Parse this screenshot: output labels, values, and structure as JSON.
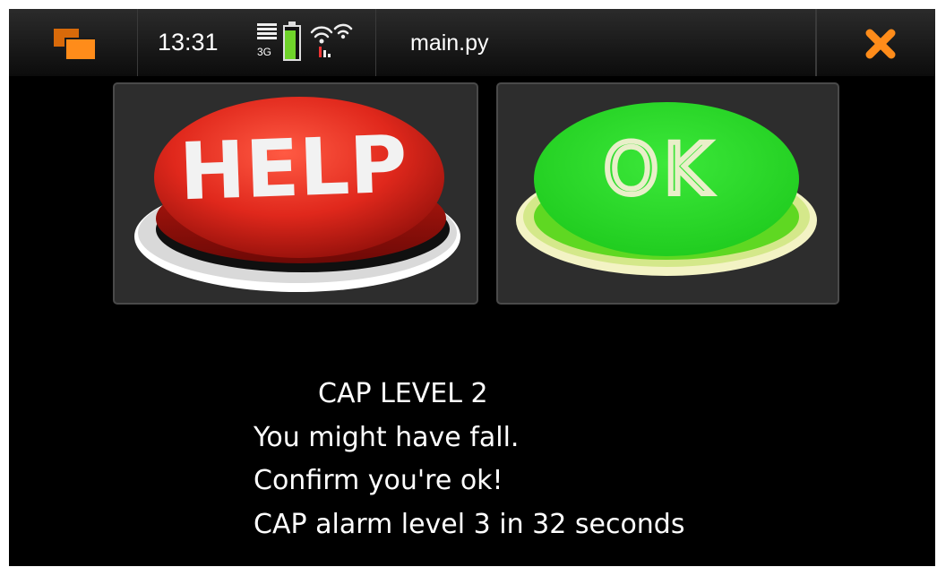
{
  "statusbar": {
    "time": "13:31",
    "network_type": "3G",
    "app_title": "main.py",
    "icons": [
      "task-switcher-icon",
      "signal-strength-icon",
      "battery-icon",
      "wifi-icon",
      "close-icon"
    ]
  },
  "buttons": {
    "help_label": "HELP",
    "ok_label": "OK"
  },
  "message": {
    "title": "CAP LEVEL 2",
    "line1": "You might have fall.",
    "line2": "Confirm you're ok!",
    "line3": "CAP alarm level 3 in 32 seconds"
  },
  "colors": {
    "accent": "#ff8c1a",
    "help_red": "#d8271c",
    "ok_green": "#22d620",
    "battery_green": "#6fd32a",
    "background": "#000000"
  }
}
